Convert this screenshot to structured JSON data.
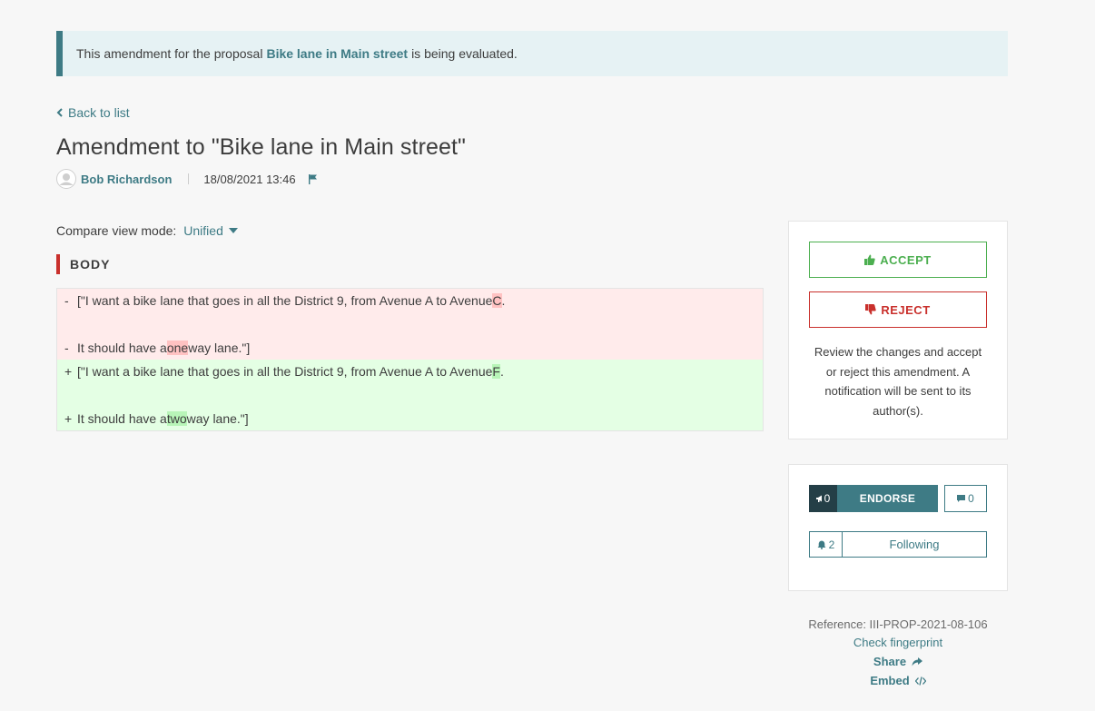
{
  "callout": {
    "prefix": "This amendment for the proposal",
    "proposal_link": "Bike lane in Main street",
    "suffix": "is being evaluated."
  },
  "nav": {
    "back_label": "Back to list"
  },
  "amendment": {
    "title": "Amendment to \"Bike lane in Main street\"",
    "author": "Bob Richardson",
    "date": "18/08/2021 13:46"
  },
  "compare": {
    "label": "Compare view mode:",
    "selected": "Unified"
  },
  "section": {
    "title": "BODY"
  },
  "diff": {
    "removed": [
      {
        "sign": "-",
        "before": "[\"I want a bike lane that goes in all the District 9, from Avenue A to Avenue ",
        "changed": "C",
        "after": "."
      },
      {
        "sign": "-",
        "before": "It should have a ",
        "changed": "one",
        "after": " way lane.\"]"
      }
    ],
    "added": [
      {
        "sign": "+",
        "before": "[\"I want a bike lane that goes in all the District 9, from Avenue A to Avenue ",
        "changed": "F",
        "after": "."
      },
      {
        "sign": "+",
        "before": "It should have a ",
        "changed": "two",
        "after": " way lane.\"]"
      }
    ]
  },
  "actions": {
    "accept_label": "ACCEPT",
    "reject_label": "REJECT",
    "help_text": "Review the changes and accept or reject this amendment. A notification will be sent to its author(s)."
  },
  "social": {
    "endorse_count": "0",
    "endorse_label": "ENDORSE",
    "comments_count": "0",
    "followers_count": "2",
    "follow_label": "Following"
  },
  "footer": {
    "reference": "Reference: III-PROP-2021-08-106",
    "fingerprint_label": "Check fingerprint",
    "share_label": "Share",
    "embed_label": "Embed"
  },
  "colors": {
    "primary": "#3e7b85",
    "accept": "#4caf50",
    "reject": "#c9302c",
    "removed_bg": "#ffebeb",
    "added_bg": "#e4ffe4"
  }
}
